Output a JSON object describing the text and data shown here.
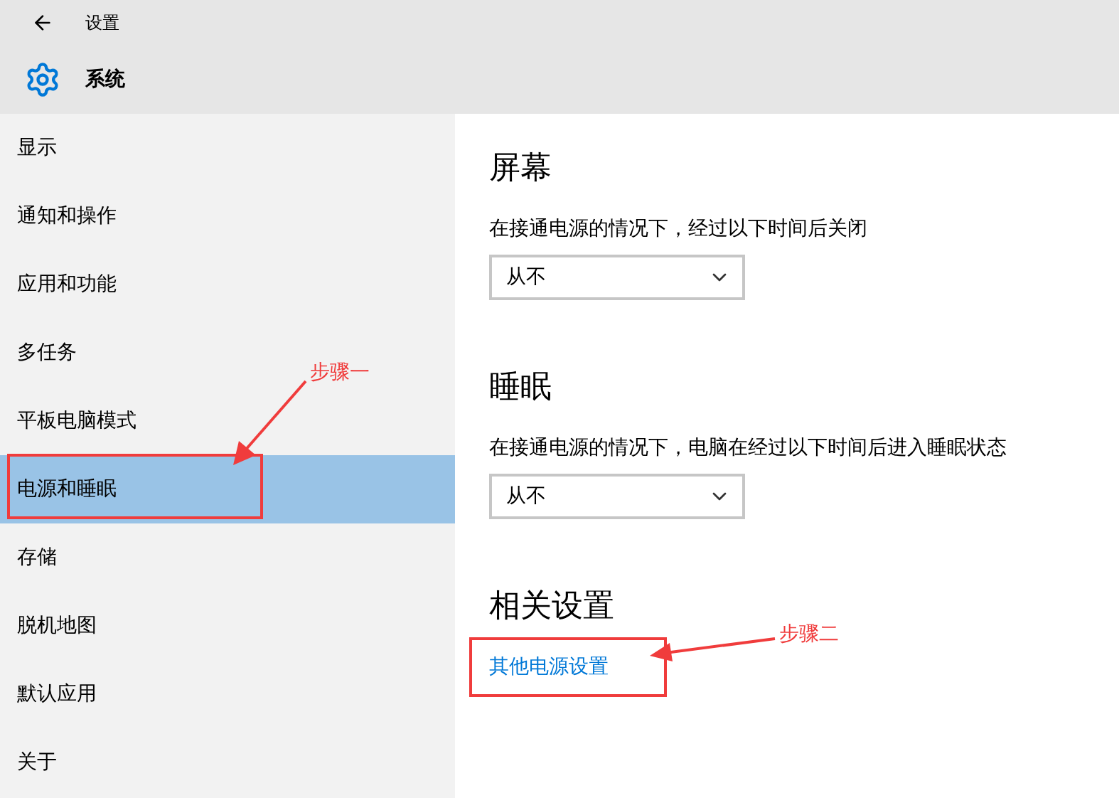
{
  "window": {
    "title": "设置",
    "section": "系统"
  },
  "sidebar": {
    "items": [
      {
        "label": "显示",
        "selected": false
      },
      {
        "label": "通知和操作",
        "selected": false
      },
      {
        "label": "应用和功能",
        "selected": false
      },
      {
        "label": "多任务",
        "selected": false
      },
      {
        "label": "平板电脑模式",
        "selected": false
      },
      {
        "label": "电源和睡眠",
        "selected": true
      },
      {
        "label": "存储",
        "selected": false
      },
      {
        "label": "脱机地图",
        "selected": false
      },
      {
        "label": "默认应用",
        "selected": false
      },
      {
        "label": "关于",
        "selected": false
      }
    ]
  },
  "sections": [
    {
      "kind": "dropdown",
      "heading": "屏幕",
      "description": "在接通电源的情况下，经过以下时间后关闭",
      "value": "从不"
    },
    {
      "kind": "dropdown",
      "heading": "睡眠",
      "description": "在接通电源的情况下，电脑在经过以下时间后进入睡眠状态",
      "value": "从不"
    },
    {
      "kind": "link",
      "heading": "相关设置",
      "link": "其他电源设置"
    }
  ],
  "annotations": [
    {
      "label": "步骤一"
    },
    {
      "label": "步骤二"
    }
  ]
}
